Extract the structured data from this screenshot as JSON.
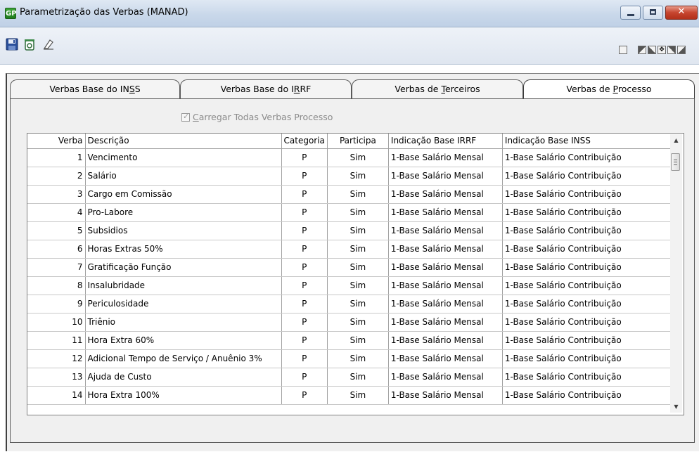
{
  "window": {
    "icon_text": "GP",
    "title": "Parametrização das Verbas (MANAD)"
  },
  "toolbar": {
    "icons": [
      "save-icon",
      "delete-icon",
      "eraser-icon"
    ],
    "right_icons": [
      "calculator-icon",
      "corner-tl-icon",
      "corner-bl-icon",
      "move-icon",
      "corner-tr-icon",
      "corner-br-icon"
    ]
  },
  "tabs": [
    {
      "label_pre": "Verbas Base do IN",
      "label_ul": "S",
      "label_post": "S",
      "active": false
    },
    {
      "label_pre": "Verbas Base do I",
      "label_ul": "R",
      "label_post": "RF",
      "active": false
    },
    {
      "label_pre": "Verbas de ",
      "label_ul": "T",
      "label_post": "erceiros",
      "active": false
    },
    {
      "label_pre": "Verbas de ",
      "label_ul": "P",
      "label_post": "rocesso",
      "active": true
    }
  ],
  "load_all": {
    "label_ul": "C",
    "label_rest": "arregar Todas Verbas Processo",
    "checked": true,
    "enabled": false
  },
  "grid": {
    "columns": {
      "verba": "Verba",
      "descricao": "Descrição",
      "categoria": "Categoria",
      "participa": "Participa",
      "irrf": "Indicação Base IRRF",
      "inss": "Indicação Base INSS"
    },
    "rows": [
      {
        "verba": "1",
        "descricao": "Vencimento",
        "categoria": "P",
        "participa": "Sim",
        "irrf": "1-Base Salário Mensal",
        "inss": "1-Base Salário Contribuição"
      },
      {
        "verba": "2",
        "descricao": "Salário",
        "categoria": "P",
        "participa": "Sim",
        "irrf": "1-Base Salário Mensal",
        "inss": "1-Base Salário Contribuição"
      },
      {
        "verba": "3",
        "descricao": "Cargo em Comissão",
        "categoria": "P",
        "participa": "Sim",
        "irrf": "1-Base Salário Mensal",
        "inss": "1-Base Salário Contribuição"
      },
      {
        "verba": "4",
        "descricao": "Pro-Labore",
        "categoria": "P",
        "participa": "Sim",
        "irrf": "1-Base Salário Mensal",
        "inss": "1-Base Salário Contribuição"
      },
      {
        "verba": "5",
        "descricao": "Subsidios",
        "categoria": "P",
        "participa": "Sim",
        "irrf": "1-Base Salário Mensal",
        "inss": "1-Base Salário Contribuição"
      },
      {
        "verba": "6",
        "descricao": "Horas Extras 50%",
        "categoria": "P",
        "participa": "Sim",
        "irrf": "1-Base Salário Mensal",
        "inss": "1-Base Salário Contribuição"
      },
      {
        "verba": "7",
        "descricao": "Gratificação Função",
        "categoria": "P",
        "participa": "Sim",
        "irrf": "1-Base Salário Mensal",
        "inss": "1-Base Salário Contribuição"
      },
      {
        "verba": "8",
        "descricao": "Insalubridade",
        "categoria": "P",
        "participa": "Sim",
        "irrf": "1-Base Salário Mensal",
        "inss": "1-Base Salário Contribuição"
      },
      {
        "verba": "9",
        "descricao": "Periculosidade",
        "categoria": "P",
        "participa": "Sim",
        "irrf": "1-Base Salário Mensal",
        "inss": "1-Base Salário Contribuição"
      },
      {
        "verba": "10",
        "descricao": "Triênio",
        "categoria": "P",
        "participa": "Sim",
        "irrf": "1-Base Salário Mensal",
        "inss": "1-Base Salário Contribuição"
      },
      {
        "verba": "11",
        "descricao": "Hora Extra 60%",
        "categoria": "P",
        "participa": "Sim",
        "irrf": "1-Base Salário Mensal",
        "inss": "1-Base Salário Contribuição"
      },
      {
        "verba": "12",
        "descricao": "Adicional Tempo de Serviço / Anuênio 3%",
        "categoria": "P",
        "participa": "Sim",
        "irrf": "1-Base Salário Mensal",
        "inss": "1-Base Salário Contribuição"
      },
      {
        "verba": "13",
        "descricao": "Ajuda de Custo",
        "categoria": "P",
        "participa": "Sim",
        "irrf": "1-Base Salário Mensal",
        "inss": "1-Base Salário Contribuição"
      },
      {
        "verba": "14",
        "descricao": "Hora Extra 100%",
        "categoria": "P",
        "participa": "Sim",
        "irrf": "1-Base Salário Mensal",
        "inss": "1-Base Salário Contribuição"
      }
    ]
  },
  "scrollbar": {
    "up_icon": "arrow-up-icon",
    "down_icon": "arrow-down-icon"
  },
  "colors": {
    "titlebar": "#c9d8ea",
    "close_button": "#c6452f",
    "panel": "#f0f0f0",
    "grid_bg": "#ffffff"
  }
}
